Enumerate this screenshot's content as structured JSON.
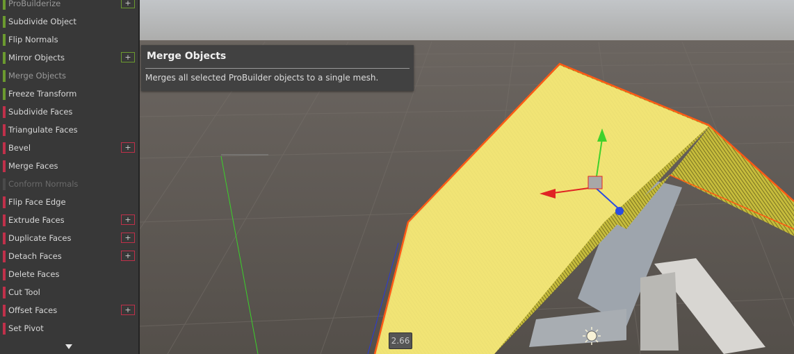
{
  "panel": {
    "items": [
      {
        "label": "ProBuilderize",
        "color": "#6b9a2f",
        "state": "dim",
        "plus": true
      },
      {
        "label": "Subdivide Object",
        "color": "#6b9a2f",
        "state": "normal",
        "plus": false
      },
      {
        "label": "Flip Normals",
        "color": "#6b9a2f",
        "state": "normal",
        "plus": false
      },
      {
        "label": "Mirror Objects",
        "color": "#6b9a2f",
        "state": "normal",
        "plus": true
      },
      {
        "label": "Merge Objects",
        "color": "#6b9a2f",
        "state": "dim",
        "plus": false
      },
      {
        "label": "Freeze Transform",
        "color": "#6b9a2f",
        "state": "normal",
        "plus": false
      },
      {
        "label": "Subdivide Faces",
        "color": "#c0304a",
        "state": "normal",
        "plus": false
      },
      {
        "label": "Triangulate Faces",
        "color": "#c0304a",
        "state": "normal",
        "plus": false
      },
      {
        "label": "Bevel",
        "color": "#c0304a",
        "state": "normal",
        "plus": true
      },
      {
        "label": "Merge Faces",
        "color": "#c0304a",
        "state": "normal",
        "plus": false
      },
      {
        "label": "Conform Normals",
        "color": "#4a4a4a",
        "state": "disabled",
        "plus": false
      },
      {
        "label": "Flip Face Edge",
        "color": "#c0304a",
        "state": "normal",
        "plus": false
      },
      {
        "label": "Extrude Faces",
        "color": "#c0304a",
        "state": "normal",
        "plus": true
      },
      {
        "label": "Duplicate Faces",
        "color": "#c0304a",
        "state": "normal",
        "plus": true
      },
      {
        "label": "Detach Faces",
        "color": "#c0304a",
        "state": "normal",
        "plus": true
      },
      {
        "label": "Delete Faces",
        "color": "#c0304a",
        "state": "normal",
        "plus": false
      },
      {
        "label": "Cut Tool",
        "color": "#c0304a",
        "state": "normal",
        "plus": false
      },
      {
        "label": "Offset Faces",
        "color": "#c0304a",
        "state": "normal",
        "plus": true
      },
      {
        "label": "Set Pivot",
        "color": "#c0304a",
        "state": "normal",
        "plus": false
      }
    ],
    "plus_glyph": "+",
    "colors": {
      "object_action": "#6b9a2f",
      "face_action": "#c0304a"
    }
  },
  "tooltip": {
    "title": "Merge Objects",
    "description": "Merges all selected ProBuilder objects to a single mesh."
  },
  "viewport": {
    "size_readout": "2.66",
    "colors": {
      "selection_outline": "#ff5a14",
      "mesh_fill": "#f4e77a",
      "x_axis": "#e02424",
      "y_axis": "#3ed12b",
      "z_axis": "#2a4ce0"
    }
  }
}
